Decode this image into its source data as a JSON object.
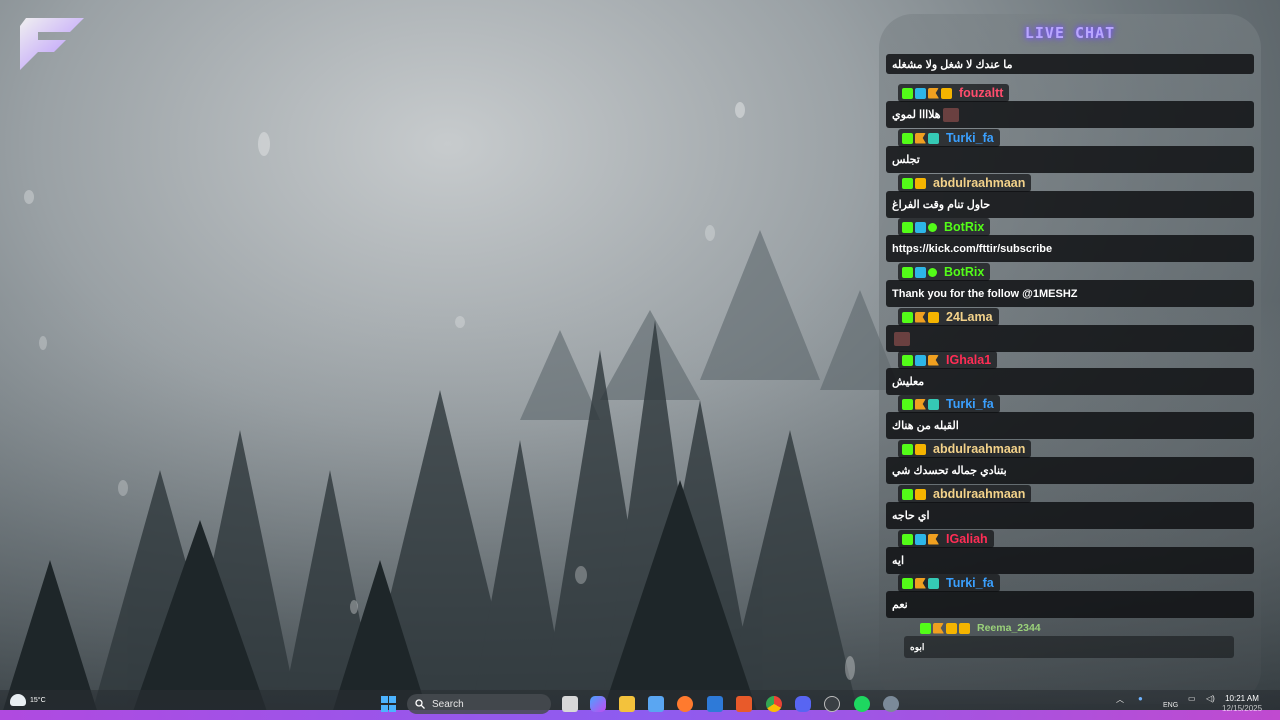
{
  "chat": {
    "title": "LIVE CHAT",
    "messages": [
      {
        "user": "",
        "text": "ما عندك لا شغل ولا مشغله",
        "color": "#ffffff",
        "badges": [],
        "emote": false
      },
      {
        "user": "fouzaltt",
        "text": "هلاااا لموي",
        "color": "#ff4d6d",
        "badges": [
          "kick",
          "blue",
          "flag",
          "sub"
        ],
        "emote": true
      },
      {
        "user": "Turki_fa",
        "text": "تجلس",
        "color": "#3aa0ff",
        "badges": [
          "kick",
          "flag",
          "gift"
        ],
        "emote": false
      },
      {
        "user": "abdulraahmaan",
        "text": "حاول تنام وقت الفراغ",
        "color": "#f3d28a",
        "badges": [
          "kick",
          "sub"
        ],
        "emote": false
      },
      {
        "user": "BotRix",
        "text": "https://kick.com/fttir/subscribe",
        "color": "#53fc18",
        "badges": [
          "kick",
          "blue",
          "verified"
        ],
        "emote": false
      },
      {
        "user": "BotRix",
        "text": "Thank you for the follow @1MESHZ",
        "color": "#53fc18",
        "badges": [
          "kick",
          "blue",
          "verified"
        ],
        "emote": false
      },
      {
        "user": "24Lama",
        "text": "",
        "color": "#f3d28a",
        "badges": [
          "kick",
          "flag",
          "sub"
        ],
        "emote": true
      },
      {
        "user": "IGhala1",
        "text": "معليش",
        "color": "#ff2d55",
        "badges": [
          "kick",
          "blue",
          "flag"
        ],
        "emote": false
      },
      {
        "user": "Turki_fa",
        "text": "القبله من هناك",
        "color": "#3aa0ff",
        "badges": [
          "kick",
          "flag",
          "gift"
        ],
        "emote": false
      },
      {
        "user": "abdulraahmaan",
        "text": "بتنادي جماله تحسدك شي",
        "color": "#f3d28a",
        "badges": [
          "kick",
          "sub"
        ],
        "emote": false
      },
      {
        "user": "abdulraahmaan",
        "text": "اي حاجه",
        "color": "#f3d28a",
        "badges": [
          "kick",
          "sub"
        ],
        "emote": false
      },
      {
        "user": "IGaliah",
        "text": "ايه",
        "color": "#ff2d55",
        "badges": [
          "kick",
          "blue",
          "flag"
        ],
        "emote": false
      },
      {
        "user": "Turki_fa",
        "text": "نعم",
        "color": "#3aa0ff",
        "badges": [
          "kick",
          "flag",
          "gift"
        ],
        "emote": false
      },
      {
        "user": "Reema_2344",
        "text": "ابوه",
        "color": "#9ad17a",
        "badges": [
          "kick",
          "flag",
          "sub",
          "sub"
        ],
        "emote": false
      }
    ]
  },
  "taskbar": {
    "weather_temp": "15°C",
    "search_placeholder": "Search",
    "clock_time": "10:21 AM",
    "clock_date": "12/15/2025",
    "lang": "ENG"
  },
  "colors": {
    "accent": "#b04ae0",
    "kick_green": "#53fc18"
  }
}
